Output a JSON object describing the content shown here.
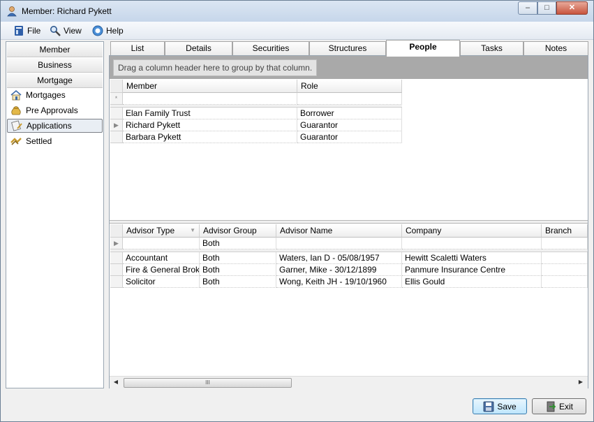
{
  "window": {
    "title": "Member: Richard Pykett"
  },
  "title_controls": {
    "minimize": "–",
    "maximize": "□",
    "close": "✕"
  },
  "menu": {
    "file": "File",
    "view": "View",
    "help": "Help"
  },
  "nav": {
    "categories": [
      "Member",
      "Business",
      "Mortgage"
    ],
    "items": [
      {
        "label": "Mortgages",
        "icon": "house-icon"
      },
      {
        "label": "Pre Approvals",
        "icon": "money-bag-icon"
      },
      {
        "label": "Applications",
        "icon": "application-icon",
        "selected": true
      },
      {
        "label": "Settled",
        "icon": "settled-icon"
      }
    ]
  },
  "tabs": [
    "List",
    "Details",
    "Securities",
    "Structures",
    "People",
    "Tasks",
    "Notes"
  ],
  "active_tab": "People",
  "group_hint": "Drag a column header here to group by that column.",
  "people_grid": {
    "columns": [
      "Member",
      "Role"
    ],
    "new_row_marker": "*",
    "current_row_marker": "▶",
    "rows": [
      [
        "Elan Family Trust",
        "Borrower"
      ],
      [
        "Richard Pykett",
        "Guarantor"
      ],
      [
        "Barbara Pykett",
        "Guarantor"
      ]
    ]
  },
  "advisor_grid": {
    "columns": [
      "Advisor Type",
      "Advisor Group",
      "Advisor Name",
      "Company",
      "Branch"
    ],
    "sort_indicator": "▼",
    "filter_row": [
      "",
      "Both",
      "",
      "",
      ""
    ],
    "rows": [
      [
        "Accountant",
        "Both",
        "Waters, Ian D - 05/08/1957",
        "Hewitt Scaletti Waters",
        ""
      ],
      [
        "Fire & General Broker",
        "Both",
        "Garner, Mike - 30/12/1899",
        "Panmure Insurance Centre",
        ""
      ],
      [
        "Solicitor",
        "Both",
        "Wong, Keith JH - 19/10/1960",
        "Ellis Gould",
        ""
      ]
    ]
  },
  "scrollbar": {
    "left_arrow": "◀",
    "right_arrow": "▶",
    "grip": "III"
  },
  "buttons": {
    "save": "Save",
    "exit": "Exit"
  }
}
